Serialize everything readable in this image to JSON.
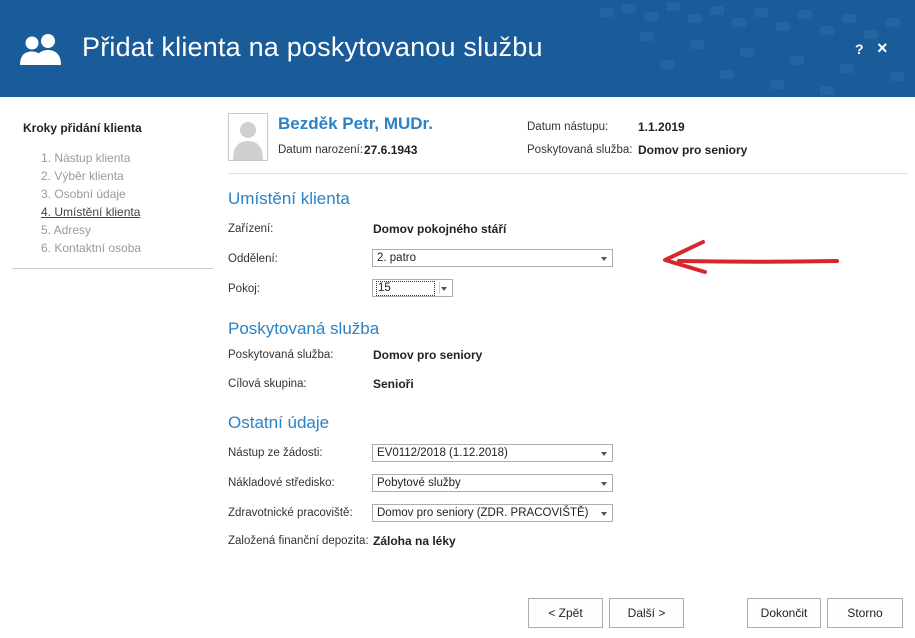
{
  "header": {
    "title": "Přidat klienta na poskytovanou službu",
    "icon": "users-icon",
    "help_label": "?",
    "close_label": "×",
    "color": "#1a5b99"
  },
  "steps": {
    "title": "Kroky přidání klienta",
    "items": [
      {
        "label": "1. Nástup klienta",
        "active": false
      },
      {
        "label": "2. Výběr klienta",
        "active": false
      },
      {
        "label": "3. Osobní údaje",
        "active": false
      },
      {
        "label": "4. Umístění klienta",
        "active": true
      },
      {
        "label": "5. Adresy",
        "active": false
      },
      {
        "label": "6. Kontaktní osoba",
        "active": false
      }
    ]
  },
  "client": {
    "name": "Bezděk Petr, MUDr.",
    "birth_label": "Datum narození:",
    "birth_value": "27.6.1943",
    "start_label": "Datum nástupu:",
    "start_value": "1.1.2019",
    "service_label": "Poskytovaná služba:",
    "service_value": "Domov pro seniory"
  },
  "placement": {
    "heading": "Umístění klienta",
    "facility_label": "Zařízení:",
    "facility_value": "Domov pokojného stáří",
    "department_label": "Oddělení:",
    "department_value": "2. patro",
    "room_label": "Pokoj:",
    "room_value": "15"
  },
  "service": {
    "heading": "Poskytovaná služba",
    "service_label": "Poskytovaná služba:",
    "service_value": "Domov pro seniory",
    "target_label": "Cílová skupina:",
    "target_value": "Senioři"
  },
  "other": {
    "heading": "Ostatní údaje",
    "request_label": "Nástup ze žádosti:",
    "request_value": "EV0112/2018 (1.12.2018)",
    "cost_label": "Nákladové středisko:",
    "cost_value": "Pobytové služby",
    "health_label": "Zdravotnické pracoviště:",
    "health_value": "Domov pro seniory (ZDR. PRACOVIŠTĚ)",
    "deposit_label": "Založená finanční depozita:",
    "deposit_value": "Záloha na léky"
  },
  "buttons": {
    "back": "< Zpět",
    "next": "Další >",
    "finish": "Dokončit",
    "cancel": "Storno"
  },
  "colors": {
    "accent": "#2a83c6",
    "annotation_arrow": "#d9262b"
  }
}
